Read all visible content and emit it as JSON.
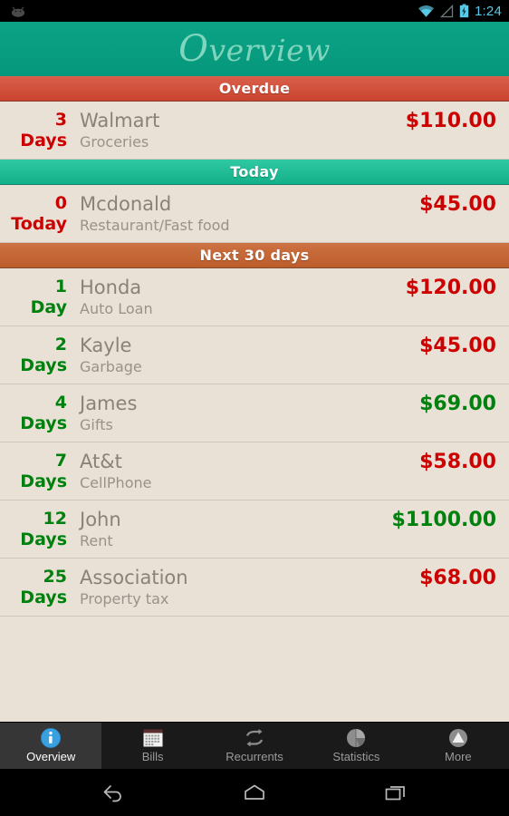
{
  "statusbar": {
    "time": "1:24",
    "icons": [
      "android-robot-icon",
      "wifi-icon",
      "signal-icon",
      "battery-charging-icon"
    ]
  },
  "header": {
    "title": "Overview",
    "title_first_letter": "O",
    "title_rest": "verview",
    "background_color": "#099a7e",
    "text_color": "#7fd6bd"
  },
  "sections": [
    {
      "label": "Overdue",
      "color": "#c9432f",
      "rows": [
        {
          "days": "3",
          "days_label": "Days",
          "days_color": "#cc0000",
          "payee": "Walmart",
          "category": "Groceries",
          "amount": "$110.00",
          "amount_sign": "negative"
        }
      ]
    },
    {
      "label": "Today",
      "color": "#12b08a",
      "rows": [
        {
          "days": "0",
          "days_label": "Today",
          "days_color": "#cc0000",
          "payee": "Mcdonald",
          "category": "Restaurant/Fast food",
          "amount": "$45.00",
          "amount_sign": "negative"
        }
      ]
    },
    {
      "label": "Next 30 days",
      "color": "#bd5c2b",
      "rows": [
        {
          "days": "1",
          "days_label": "Day",
          "days_color": "#00800d",
          "payee": "Honda",
          "category": "Auto Loan",
          "amount": "$120.00",
          "amount_sign": "negative"
        },
        {
          "days": "2",
          "days_label": "Days",
          "days_color": "#00800d",
          "payee": "Kayle",
          "category": "Garbage",
          "amount": "$45.00",
          "amount_sign": "negative"
        },
        {
          "days": "4",
          "days_label": "Days",
          "days_color": "#00800d",
          "payee": "James",
          "category": "Gifts",
          "amount": "$69.00",
          "amount_sign": "positive"
        },
        {
          "days": "7",
          "days_label": "Days",
          "days_color": "#00800d",
          "payee": "At&t",
          "category": "CellPhone",
          "amount": "$58.00",
          "amount_sign": "negative"
        },
        {
          "days": "12",
          "days_label": "Days",
          "days_color": "#00800d",
          "payee": "John",
          "category": "Rent",
          "amount": "$1100.00",
          "amount_sign": "positive"
        },
        {
          "days": "25",
          "days_label": "Days",
          "days_color": "#00800d",
          "payee": "Association",
          "category": "Property tax",
          "amount": "$68.00",
          "amount_sign": "negative"
        }
      ]
    }
  ],
  "tabs": [
    {
      "label": "Overview",
      "icon": "info-circle-icon",
      "active": true
    },
    {
      "label": "Bills",
      "icon": "calendar-icon",
      "active": false
    },
    {
      "label": "Recurrents",
      "icon": "repeat-icon",
      "active": false
    },
    {
      "label": "Statistics",
      "icon": "pie-chart-icon",
      "active": false
    },
    {
      "label": "More",
      "icon": "triangle-up-icon",
      "active": false
    }
  ],
  "navbar": {
    "buttons": [
      {
        "name": "back-button",
        "icon": "back-arrow-icon"
      },
      {
        "name": "home-button",
        "icon": "home-pentagon-icon"
      },
      {
        "name": "recents-button",
        "icon": "recents-squares-icon"
      }
    ]
  }
}
